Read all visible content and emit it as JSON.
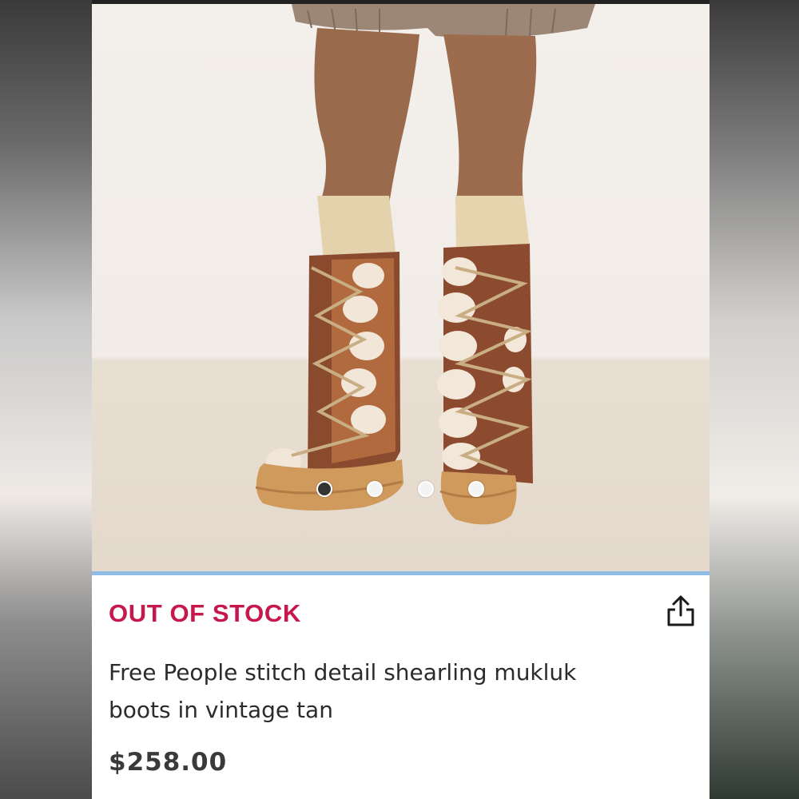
{
  "product": {
    "stock_status": "OUT OF STOCK",
    "title_line1": "Free People stitch detail shearling mukluk",
    "title_line2": "boots in vintage tan",
    "price": "$258.00"
  },
  "carousel": {
    "total": 4,
    "active_index": 1
  },
  "icons": {
    "share": "share-icon"
  },
  "colors": {
    "stock_status": "#c6184c",
    "divider": "#8fbde8"
  }
}
